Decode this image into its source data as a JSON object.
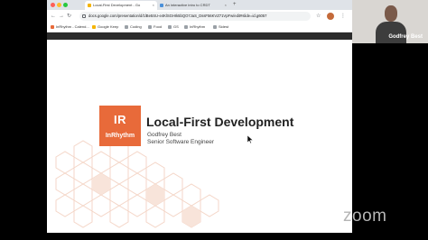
{
  "browser": {
    "tabs": [
      {
        "label": "Local-First Development - Go",
        "active": true
      },
      {
        "label": "An interactive intro to CRDT",
        "active": false
      }
    ],
    "url": "docs.google.com/presentation/d/1lBe5SU-e4KlSGHIk5bQO7JaS_DssF56KVZ71VpFw/edit#slide=id.g6057",
    "bookmarks": [
      "InRhythm - Calend...",
      "Google Keep",
      "Coding",
      "Food",
      "GS",
      "InRhythm",
      "Sidest"
    ]
  },
  "slide": {
    "logo_initials": "IR",
    "logo_name": "InRhythm",
    "title": "Local-First Development",
    "presenter_name": "Godfrey Best",
    "presenter_role": "Senior Software Engineer"
  },
  "participant": {
    "name": "Godfrey Best"
  },
  "watermark": "zoom",
  "colors": {
    "accent": "#e86a3a",
    "honeycomb": "#f4d6c8"
  }
}
